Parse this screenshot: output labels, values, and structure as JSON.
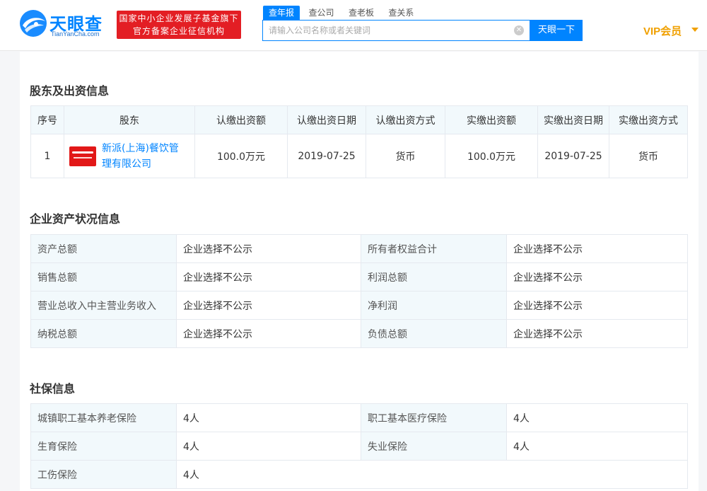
{
  "header": {
    "logo_cn": "天眼查",
    "logo_en": "TianYanCha.com",
    "promo_line1": "国家中小企业发展子基金旗下",
    "promo_line2": "官方备案企业征信机构",
    "search_tabs": [
      "查年报",
      "查公司",
      "查老板",
      "查关系"
    ],
    "search_placeholder": "请输入公司名称或者关键词",
    "search_button": "天眼一下",
    "vip_label": "VIP会员"
  },
  "shareholders": {
    "title": "股东及出资信息",
    "columns": [
      "序号",
      "股东",
      "认缴出资额",
      "认缴出资日期",
      "认缴出资方式",
      "实缴出资额",
      "实缴出资日期",
      "实缴出资方式"
    ],
    "rows": [
      {
        "index": "1",
        "name": "新派(上海)餐饮管理有限公司",
        "subscribed_amount": "100.0万元",
        "subscribed_date": "2019-07-25",
        "subscribed_method": "货币",
        "paid_amount": "100.0万元",
        "paid_date": "2019-07-25",
        "paid_method": "货币"
      }
    ]
  },
  "assets": {
    "title": "企业资产状况信息",
    "rows": [
      {
        "k1": "资产总额",
        "v1": "企业选择不公示",
        "k2": "所有者权益合计",
        "v2": "企业选择不公示"
      },
      {
        "k1": "销售总额",
        "v1": "企业选择不公示",
        "k2": "利润总额",
        "v2": "企业选择不公示"
      },
      {
        "k1": "营业总收入中主营业务收入",
        "v1": "企业选择不公示",
        "k2": "净利润",
        "v2": "企业选择不公示"
      },
      {
        "k1": "纳税总额",
        "v1": "企业选择不公示",
        "k2": "负债总额",
        "v2": "企业选择不公示"
      }
    ]
  },
  "social_security": {
    "title": "社保信息",
    "rows": [
      {
        "k1": "城镇职工基本养老保险",
        "v1": "4人",
        "k2": "职工基本医疗保险",
        "v2": "4人"
      },
      {
        "k1": "生育保险",
        "v1": "4人",
        "k2": "失业保险",
        "v2": "4人"
      },
      {
        "k1": "工伤保险",
        "v1": "4人"
      }
    ]
  },
  "colors": {
    "brand_blue": "#0084ff",
    "promo_red": "#e31e24",
    "vip_gold": "#f0a000",
    "header_cell_bg": "#f2f9fc"
  }
}
